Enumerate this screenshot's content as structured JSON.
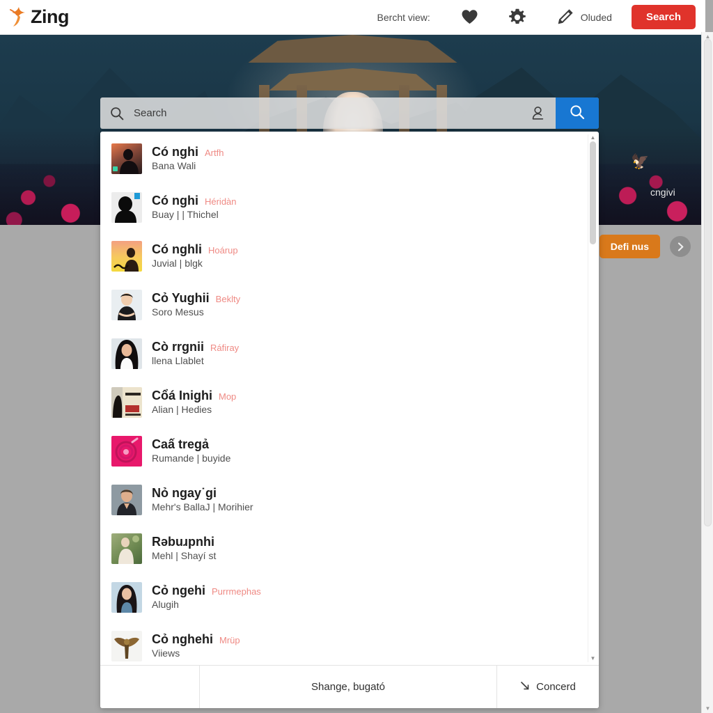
{
  "header": {
    "logo_text": "Zing",
    "logo_icon": "bird-logo-icon",
    "view_label": "Bercht view:",
    "heart_icon": "heart-icon",
    "gear_icon": "gear-icon",
    "pen_icon": "pen-icon",
    "pen_label": "Oluded",
    "search_button": "Search",
    "accent_red": "#e0332b"
  },
  "hero": {
    "bird_glyph": "🦅",
    "bird_label": "cngivi"
  },
  "promo": {
    "button_label": "Defi nus",
    "next_icon": "chevron-right-icon",
    "accent_orange": "#d9791b"
  },
  "search": {
    "placeholder": "Search",
    "value": "",
    "magnifier_icon": "search-icon",
    "voice_icon": "person-search-icon",
    "submit_icon": "search-icon",
    "submit_color": "#1877d2"
  },
  "suggestions": {
    "items": [
      {
        "title": "Có nghi",
        "tag": "Artfh",
        "subtitle": "Bana Wali"
      },
      {
        "title": "Có nghi",
        "tag": "Héridàn",
        "subtitle": "Buay | | Thichel"
      },
      {
        "title": "Có nghli",
        "tag": "Hoárup",
        "subtitle": "Juvial | blgk"
      },
      {
        "title": "Cỏ Yughii",
        "tag": "Beklty",
        "subtitle": "Soro Mesus"
      },
      {
        "title": "Cò rrgnii",
        "tag": "Ráfiray",
        "subtitle": "llena Llablet"
      },
      {
        "title": "Cổá Inighi",
        "tag": "Mop",
        "subtitle": "Alian | Hedies"
      },
      {
        "title": "Caấ tregả",
        "tag": "",
        "subtitle": "Rumande | buyide"
      },
      {
        "title": "Nỏ ngay˙gi",
        "tag": "",
        "subtitle": "Mehr's BallaJ | Morihier"
      },
      {
        "title": "Rəbuɹpnhi",
        "tag": "",
        "subtitle": "Mehl | Shayí st"
      },
      {
        "title": "Cỏ ngehi",
        "tag": "Purrmephas",
        "subtitle": "Alugih"
      },
      {
        "title": "Cỏ nghehi",
        "tag": "Mrüp",
        "subtitle": "Viiews"
      }
    ],
    "tag_color": "#ef8a84"
  },
  "suggest_footer": {
    "left_label": "",
    "center_label": "Shange, bugató",
    "right_label": "Concerd",
    "right_icon": "arrow-down-right-icon"
  }
}
